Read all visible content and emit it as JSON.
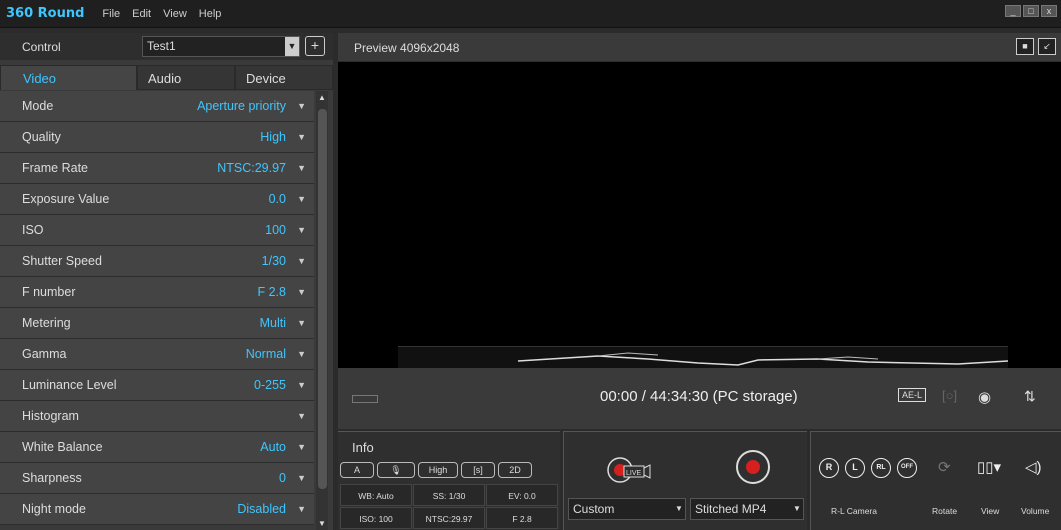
{
  "app": {
    "name": "360 Round"
  },
  "menu": [
    "File",
    "Edit",
    "View",
    "Help"
  ],
  "window_controls": [
    "_",
    "□",
    "x"
  ],
  "control": {
    "label": "Control",
    "profile": "Test1"
  },
  "tabs": [
    "Video",
    "Audio",
    "Device"
  ],
  "settings": [
    {
      "label": "Mode",
      "value": "Aperture priority"
    },
    {
      "label": "Quality",
      "value": "High"
    },
    {
      "label": "Frame Rate",
      "value": "NTSC:29.97"
    },
    {
      "label": "Exposure Value",
      "value": "0.0"
    },
    {
      "label": "ISO",
      "value": "100"
    },
    {
      "label": "Shutter Speed",
      "value": "1/30"
    },
    {
      "label": "F number",
      "value": "F 2.8"
    },
    {
      "label": "Metering",
      "value": "Multi"
    },
    {
      "label": "Gamma",
      "value": "Normal"
    },
    {
      "label": "Luminance Level",
      "value": "0-255"
    },
    {
      "label": "Histogram",
      "value": ""
    },
    {
      "label": "White Balance",
      "value": "Auto"
    },
    {
      "label": "Sharpness",
      "value": "0"
    },
    {
      "label": "Night mode",
      "value": "Disabled"
    }
  ],
  "preview": {
    "title": "Preview 4096x2048"
  },
  "transport": {
    "time": "00:00 / 44:34:30 (PC storage)"
  },
  "info": {
    "title": "Info",
    "buttons": [
      "A",
      "🎙",
      "High",
      "[s]",
      "2D"
    ],
    "cells": [
      [
        "WB: Auto",
        "SS: 1/30",
        "EV: 0.0"
      ],
      [
        "ISO: 100",
        "NTSC:29.97",
        "F 2.8"
      ]
    ]
  },
  "record": {
    "live_label": "LIVE",
    "stream_select": "Custom",
    "format_select": "Stitched MP4"
  },
  "camera": {
    "buttons": [
      "R",
      "L",
      "RL",
      "OFF"
    ],
    "labels": {
      "rl": "R-L Camera",
      "rotate": "Rotate",
      "view": "View",
      "volume": "Volume"
    }
  },
  "colors": {
    "accent": "#3ec6ff",
    "record": "#d62020"
  }
}
